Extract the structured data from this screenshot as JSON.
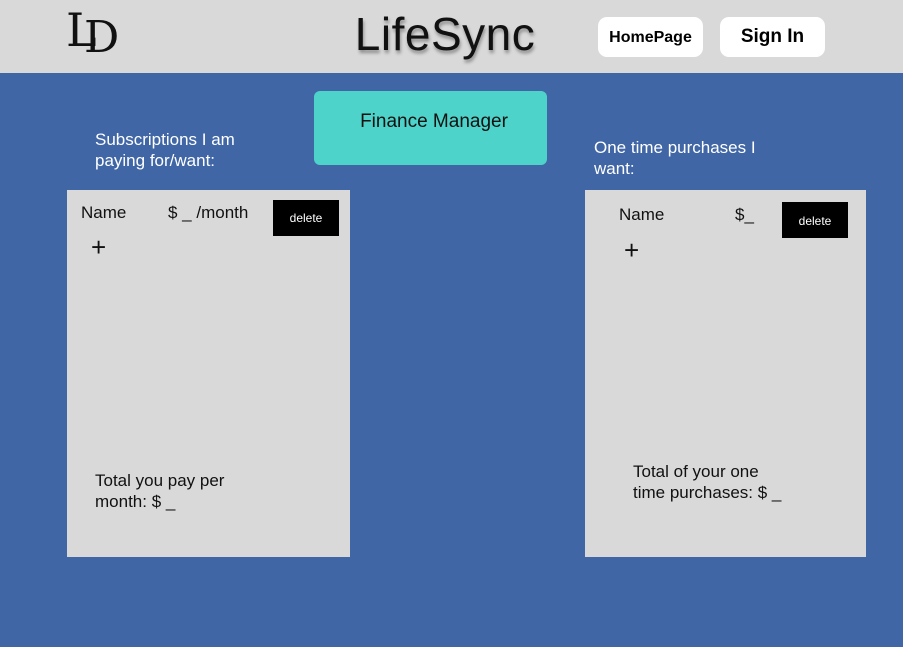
{
  "header": {
    "logo": {
      "first": "L",
      "second": "D"
    },
    "title": "LifeSync",
    "home_label": "HomePage",
    "signin_label": "Sign In"
  },
  "main": {
    "finance_button_label": "Finance Manager",
    "subscriptions": {
      "heading_line1": "Subscriptions I am",
      "heading_line2": "paying for/want:",
      "item_name": "Name",
      "item_price": "$ _ /month",
      "delete_label": "delete",
      "add_symbol": "+",
      "total_line1": "Total you pay per",
      "total_line2": "month:  $ _"
    },
    "one_time": {
      "heading_line1": "One time purchases I",
      "heading_line2": "want:",
      "item_name": "Name",
      "item_price": "$_",
      "delete_label": "delete",
      "add_symbol": "+",
      "total_line1": "Total of your one",
      "total_line2": "time purchases: $ _"
    }
  },
  "colors": {
    "background": "#4066a6",
    "header": "#d9d9d9",
    "panel": "#d9d9d9",
    "accent": "#4dd3c9",
    "delete_button": "#000000"
  }
}
